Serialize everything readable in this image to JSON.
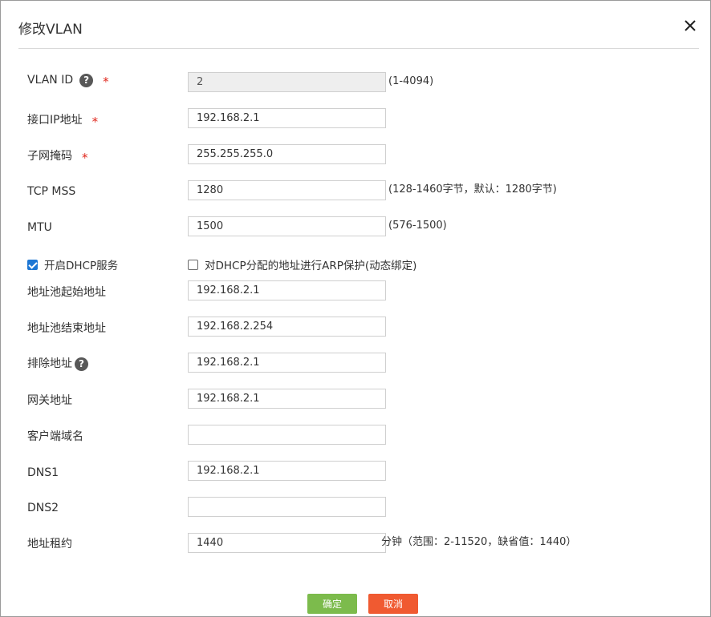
{
  "dialog": {
    "title": "修改VLAN",
    "close_icon": "close-icon"
  },
  "fields": {
    "vlan_id": {
      "label": "VLAN ID",
      "value": "2",
      "hint": "(1-4094)",
      "required": true,
      "help": true
    },
    "interface_ip": {
      "label": "接口IP地址",
      "value": "192.168.2.1",
      "required": true
    },
    "subnet_mask": {
      "label": "子网掩码",
      "value": "255.255.255.0",
      "required": true
    },
    "tcp_mss": {
      "label": "TCP MSS",
      "value": "1280",
      "hint": "(128-1460字节，默认：1280字节)"
    },
    "mtu": {
      "label": "MTU",
      "value": "1500",
      "hint": "(576-1500)"
    },
    "pool_start": {
      "label": "地址池起始地址",
      "value": "192.168.2.1"
    },
    "pool_end": {
      "label": "地址池结束地址",
      "value": "192.168.2.254"
    },
    "excluded": {
      "label": "排除地址",
      "value": "192.168.2.1",
      "help": true
    },
    "gateway": {
      "label": "网关地址",
      "value": "192.168.2.1"
    },
    "client_domain": {
      "label": "客户端域名",
      "value": ""
    },
    "dns1": {
      "label": "DNS1",
      "value": "192.168.2.1"
    },
    "dns2": {
      "label": "DNS2",
      "value": ""
    },
    "lease": {
      "label": "地址租约",
      "value": "1440",
      "hint": "分钟（范围：2-11520，缺省值：1440）"
    }
  },
  "options": {
    "enable_dhcp": {
      "label": "开启DHCP服务",
      "checked": true
    },
    "arp_protect": {
      "label": "对DHCP分配的地址进行ARP保护(动态绑定)",
      "checked": false
    }
  },
  "required_mark": "*",
  "help_mark": "?",
  "buttons": {
    "ok": "确定",
    "cancel": "取消"
  },
  "colors": {
    "required": "#e0261b",
    "ok_button": "#7cbb4c",
    "cancel_button": "#f05a31",
    "checkbox_checked": "#1e77d4"
  }
}
